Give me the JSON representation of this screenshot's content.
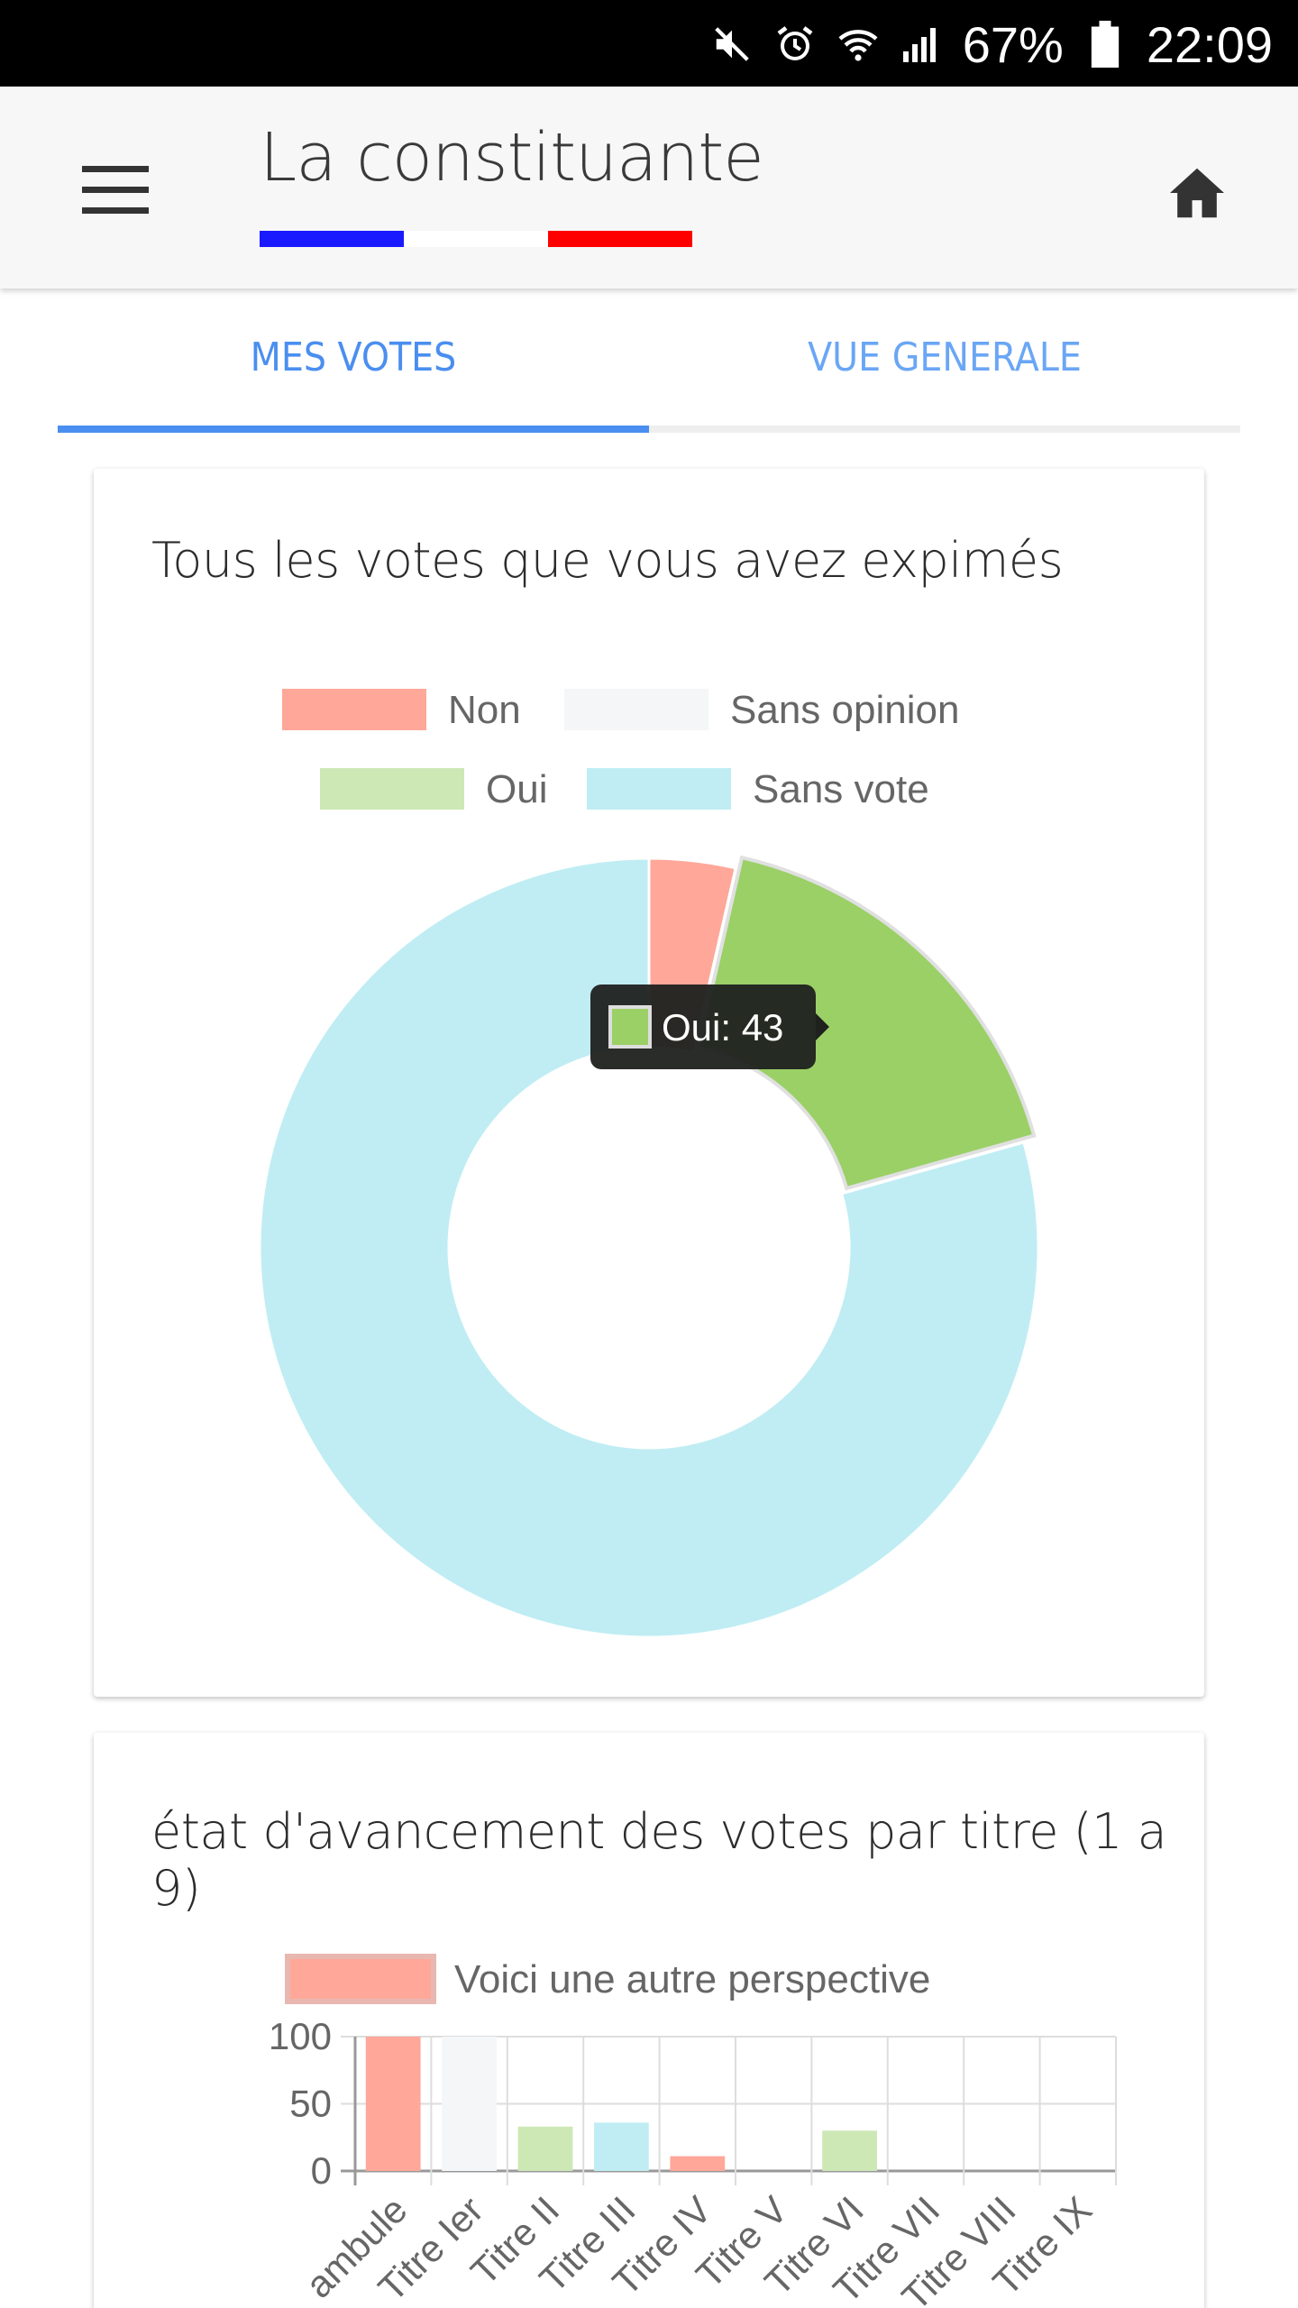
{
  "status_bar": {
    "battery": "67%",
    "time": "22:09",
    "icons": [
      "mute-icon",
      "alarm-icon",
      "wifi-icon",
      "signal-icon",
      "battery-icon"
    ]
  },
  "app_bar": {
    "title": "La constituante",
    "menu_icon": "menu-icon",
    "home_icon": "home-icon",
    "flag_colors": [
      "#1a1aff",
      "#ffffff",
      "#ff0000"
    ]
  },
  "tabs": [
    {
      "label": "MES VOTES",
      "active": true
    },
    {
      "label": "VUE GENERALE",
      "active": false
    }
  ],
  "colors": {
    "accent": "#4a8ef0",
    "non": "#ffa799",
    "sans_opinion": "#f5f6f7",
    "oui": "#cde8b5",
    "oui_highlight": "#9ad066",
    "sans_vote": "#bfedf3"
  },
  "card1": {
    "title": "Tous les votes que vous avez expimés"
  },
  "card2": {
    "title": "état d'avancement des votes par titre (1 a 9)"
  },
  "chart_data": [
    {
      "type": "pie",
      "variant": "doughnut",
      "legend_position": "top",
      "categories": [
        "Non",
        "Sans opinion",
        "Oui",
        "Sans vote"
      ],
      "values": [
        9,
        0,
        43,
        200
      ],
      "colors": [
        "#ffa799",
        "#f5f6f7",
        "#cde8b5",
        "#bfedf3"
      ],
      "tooltip": {
        "label": "Oui",
        "value": 43,
        "text": "Oui: 43"
      }
    },
    {
      "type": "bar",
      "legend": "Voici une autre perspective",
      "legend_position": "top",
      "categories": [
        "Préambule",
        "Titre Ier",
        "Titre II",
        "Titre III",
        "Titre IV",
        "Titre V",
        "Titre VI",
        "Titre VII",
        "Titre VIII",
        "Titre IX"
      ],
      "tick_labels_visible": [
        "ambule",
        "Titre Ier",
        "Titre II",
        "Titre III",
        "Titre IV",
        "Titre V",
        "Titre VI",
        "Titre VII",
        "Titre VIII",
        "Titre IX"
      ],
      "values": [
        100,
        100,
        33,
        36,
        11,
        0,
        30,
        0,
        0,
        0
      ],
      "bar_colors": [
        "#ffa799",
        "#f5f6f7",
        "#cde8b5",
        "#bfedf3",
        "#ffa799",
        "#ffa799",
        "#cde8b5",
        "#ffa799",
        "#ffa799",
        "#ffa799"
      ],
      "y_ticks": [
        0,
        50,
        100
      ],
      "ylim": [
        0,
        100
      ],
      "grid": true
    }
  ]
}
